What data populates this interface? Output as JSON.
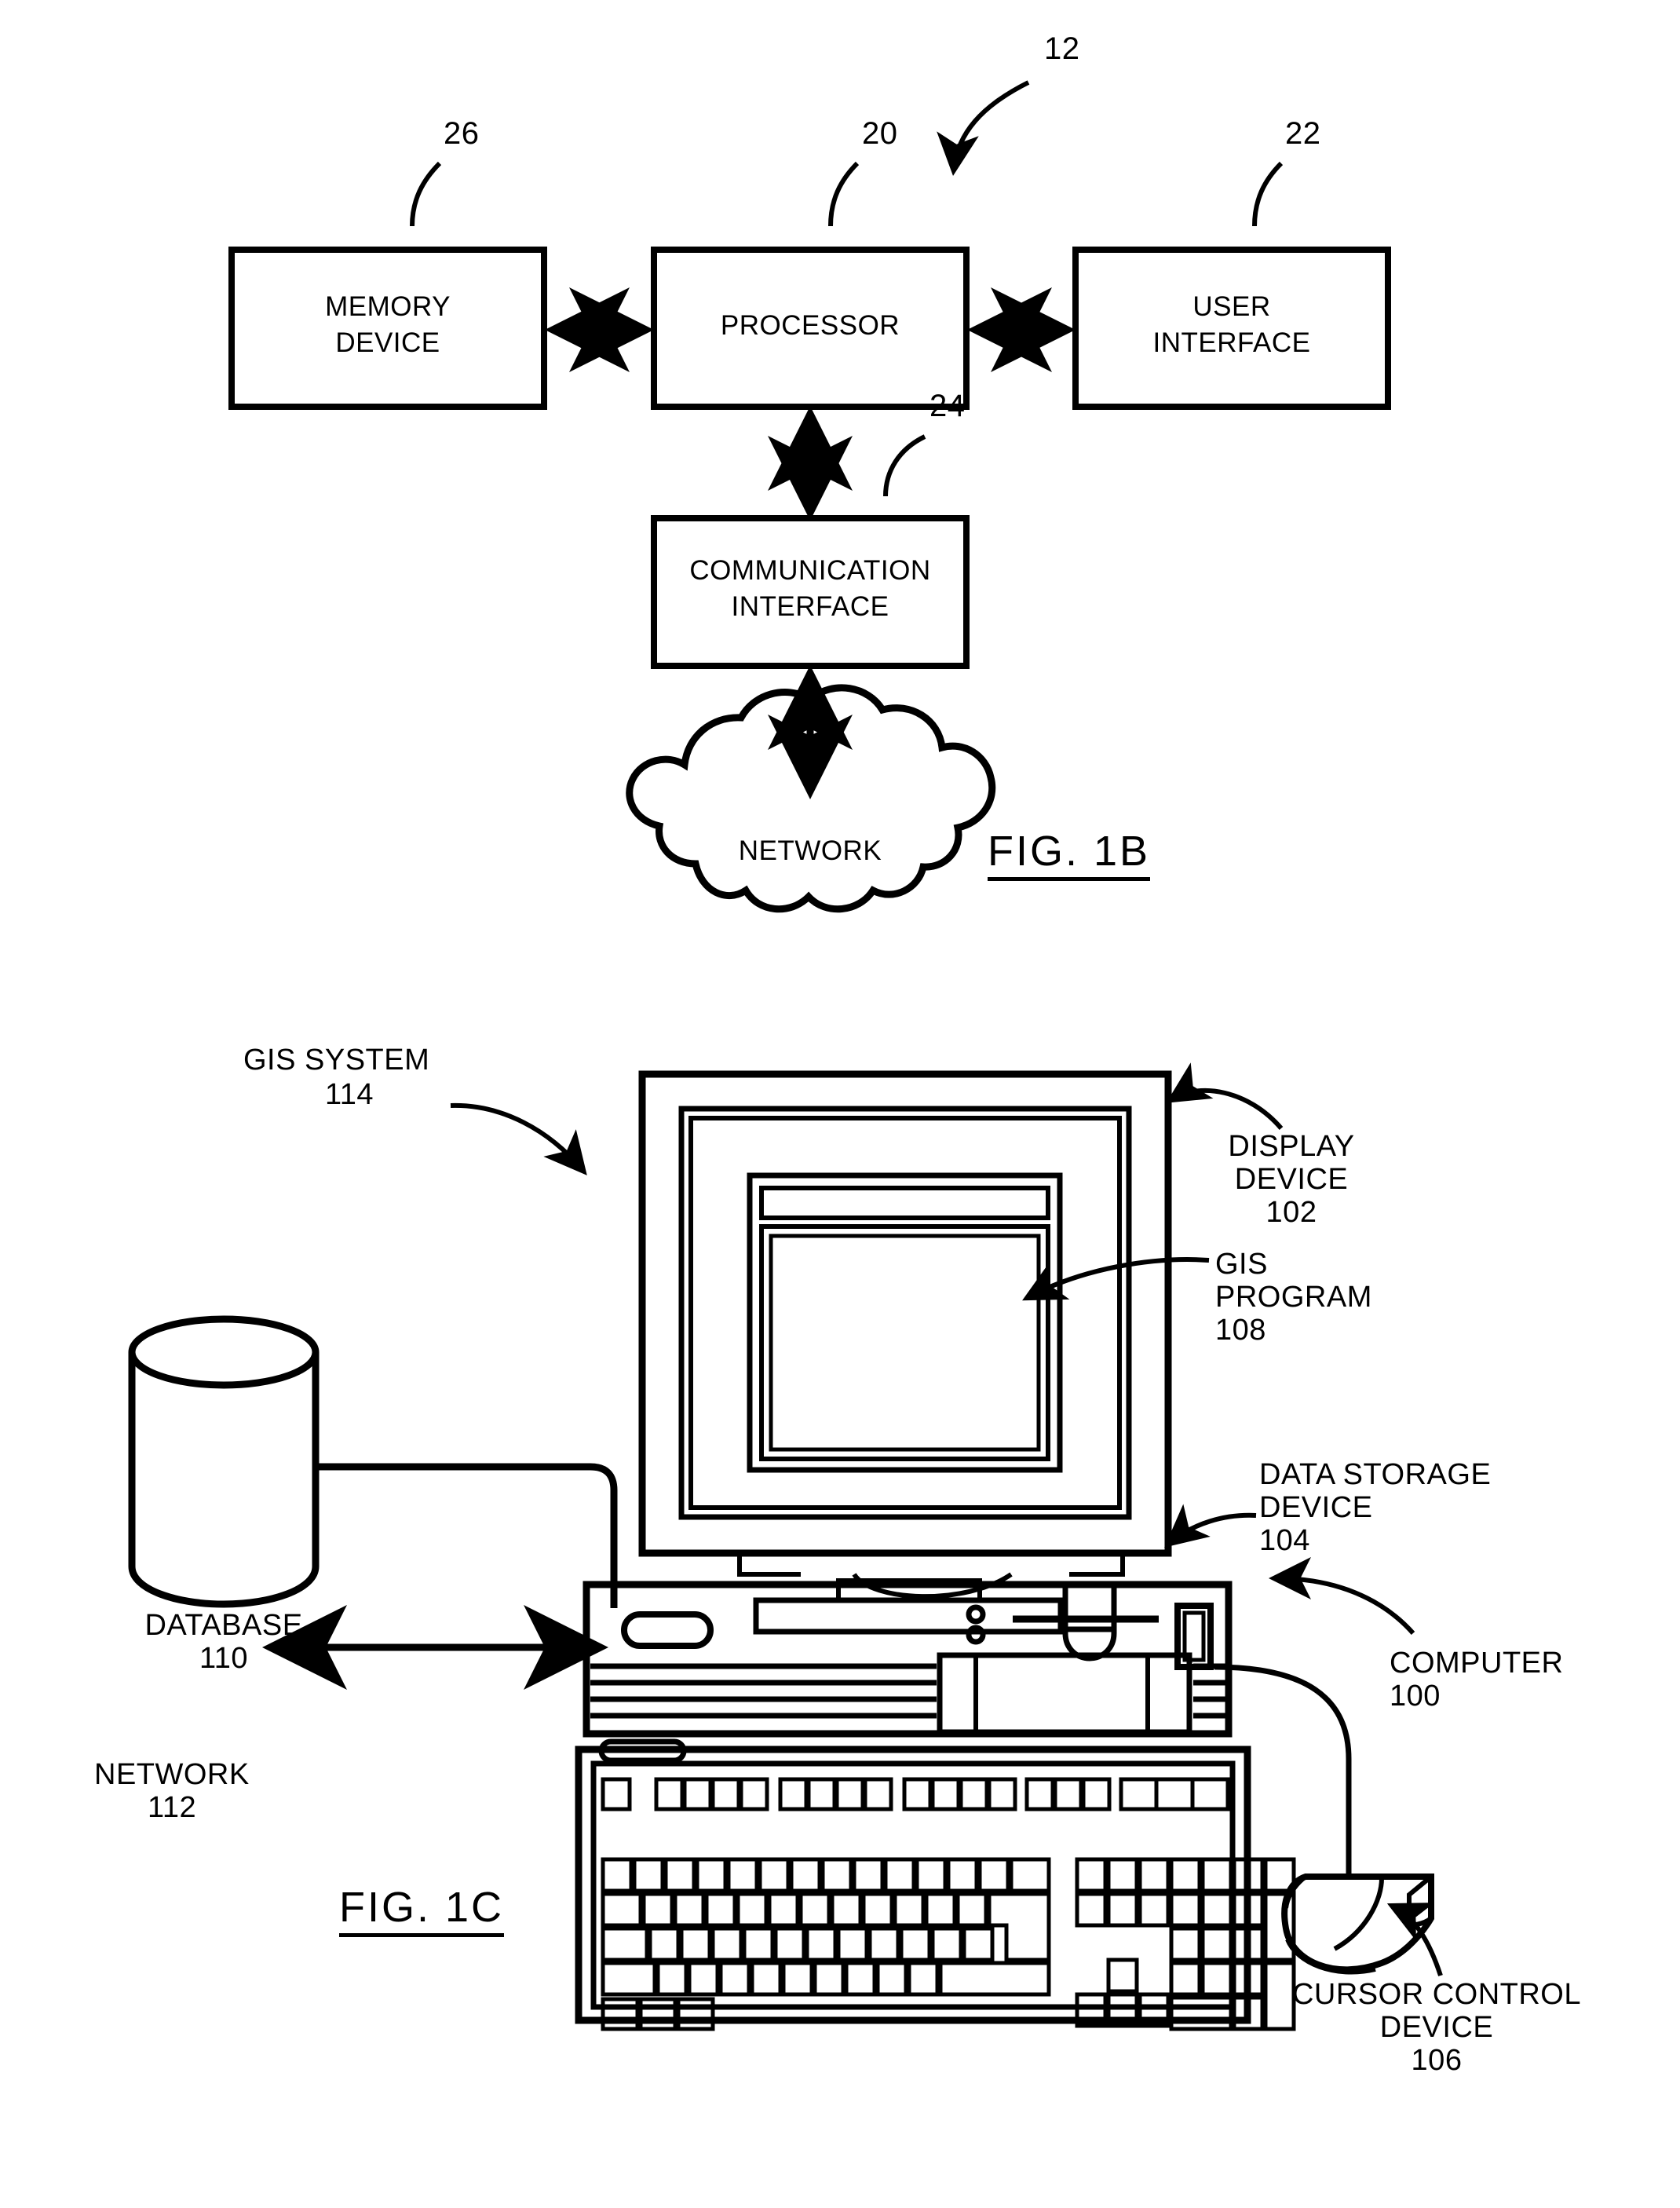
{
  "document": {
    "type": "patent-drawing-sheet",
    "figures": [
      "FIG. 1B",
      "FIG. 1C"
    ]
  },
  "fig1b": {
    "figure_label": "FIG. 1B",
    "system_ref": "12",
    "blocks": [
      {
        "id": "memory",
        "label_line1": "MEMORY",
        "label_line2": "DEVICE",
        "ref": "26"
      },
      {
        "id": "processor",
        "label_line1": "PROCESSOR",
        "label_line2": "",
        "ref": "20"
      },
      {
        "id": "ui",
        "label_line1": "USER",
        "label_line2": "INTERFACE",
        "ref": "22"
      },
      {
        "id": "comm",
        "label_line1": "COMMUNICATION",
        "label_line2": "INTERFACE",
        "ref": "24"
      }
    ],
    "cloud": {
      "label": "NETWORK"
    }
  },
  "fig1c": {
    "figure_label": "FIG. 1C",
    "callouts": [
      {
        "id": "gis-system",
        "line1": "GIS SYSTEM",
        "line2": "",
        "ref": "114"
      },
      {
        "id": "display-device",
        "line1": "DISPLAY",
        "line2": "DEVICE",
        "ref": "102"
      },
      {
        "id": "gis-program",
        "line1": "GIS",
        "line2": "PROGRAM",
        "ref": "108"
      },
      {
        "id": "data-storage",
        "line1": "DATA STORAGE",
        "line2": "DEVICE",
        "ref": "104"
      },
      {
        "id": "computer",
        "line1": "COMPUTER",
        "line2": "",
        "ref": "100"
      },
      {
        "id": "database",
        "line1": "DATABASE",
        "line2": "",
        "ref": "110"
      },
      {
        "id": "network",
        "line1": "NETWORK",
        "line2": "",
        "ref": "112"
      },
      {
        "id": "cursor-control",
        "line1": "CURSOR CONTROL",
        "line2": "DEVICE",
        "ref": "106"
      }
    ]
  },
  "colors": {
    "ink": "#000000",
    "paper": "#ffffff"
  }
}
